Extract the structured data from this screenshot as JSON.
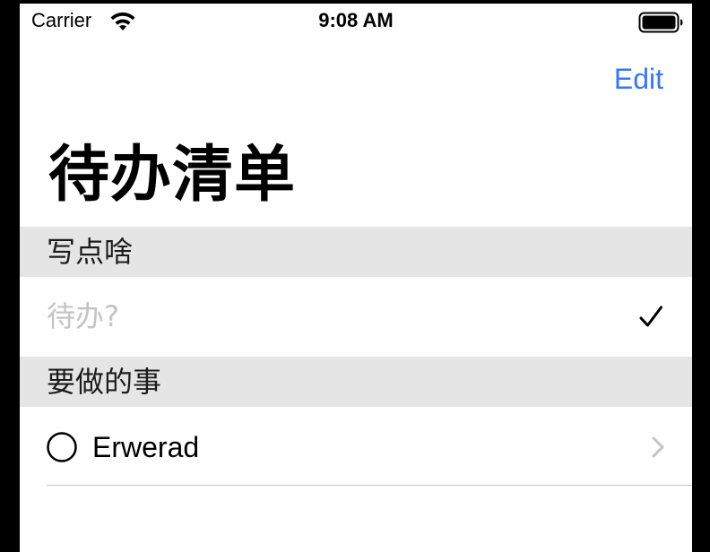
{
  "status_bar": {
    "carrier": "Carrier",
    "time": "9:08 AM",
    "wifi_icon": "wifi-icon",
    "battery_icon": "battery-icon"
  },
  "nav": {
    "edit_label": "Edit",
    "title": "待办清单"
  },
  "sections": [
    {
      "header": "写点啥",
      "input": {
        "value": "",
        "placeholder": "待办?",
        "submit_icon": "checkmark-icon"
      }
    },
    {
      "header": "要做的事",
      "items": [
        {
          "label": "Erwerad",
          "done": false,
          "status_icon": "circle-icon",
          "accessory_icon": "chevron-right-icon"
        }
      ]
    }
  ],
  "colors": {
    "accent": "#3478f6",
    "section_bg": "#e5e5e5",
    "placeholder": "#c4c4c6",
    "separator": "#c8c7cc",
    "chevron": "#c4c4c6"
  }
}
